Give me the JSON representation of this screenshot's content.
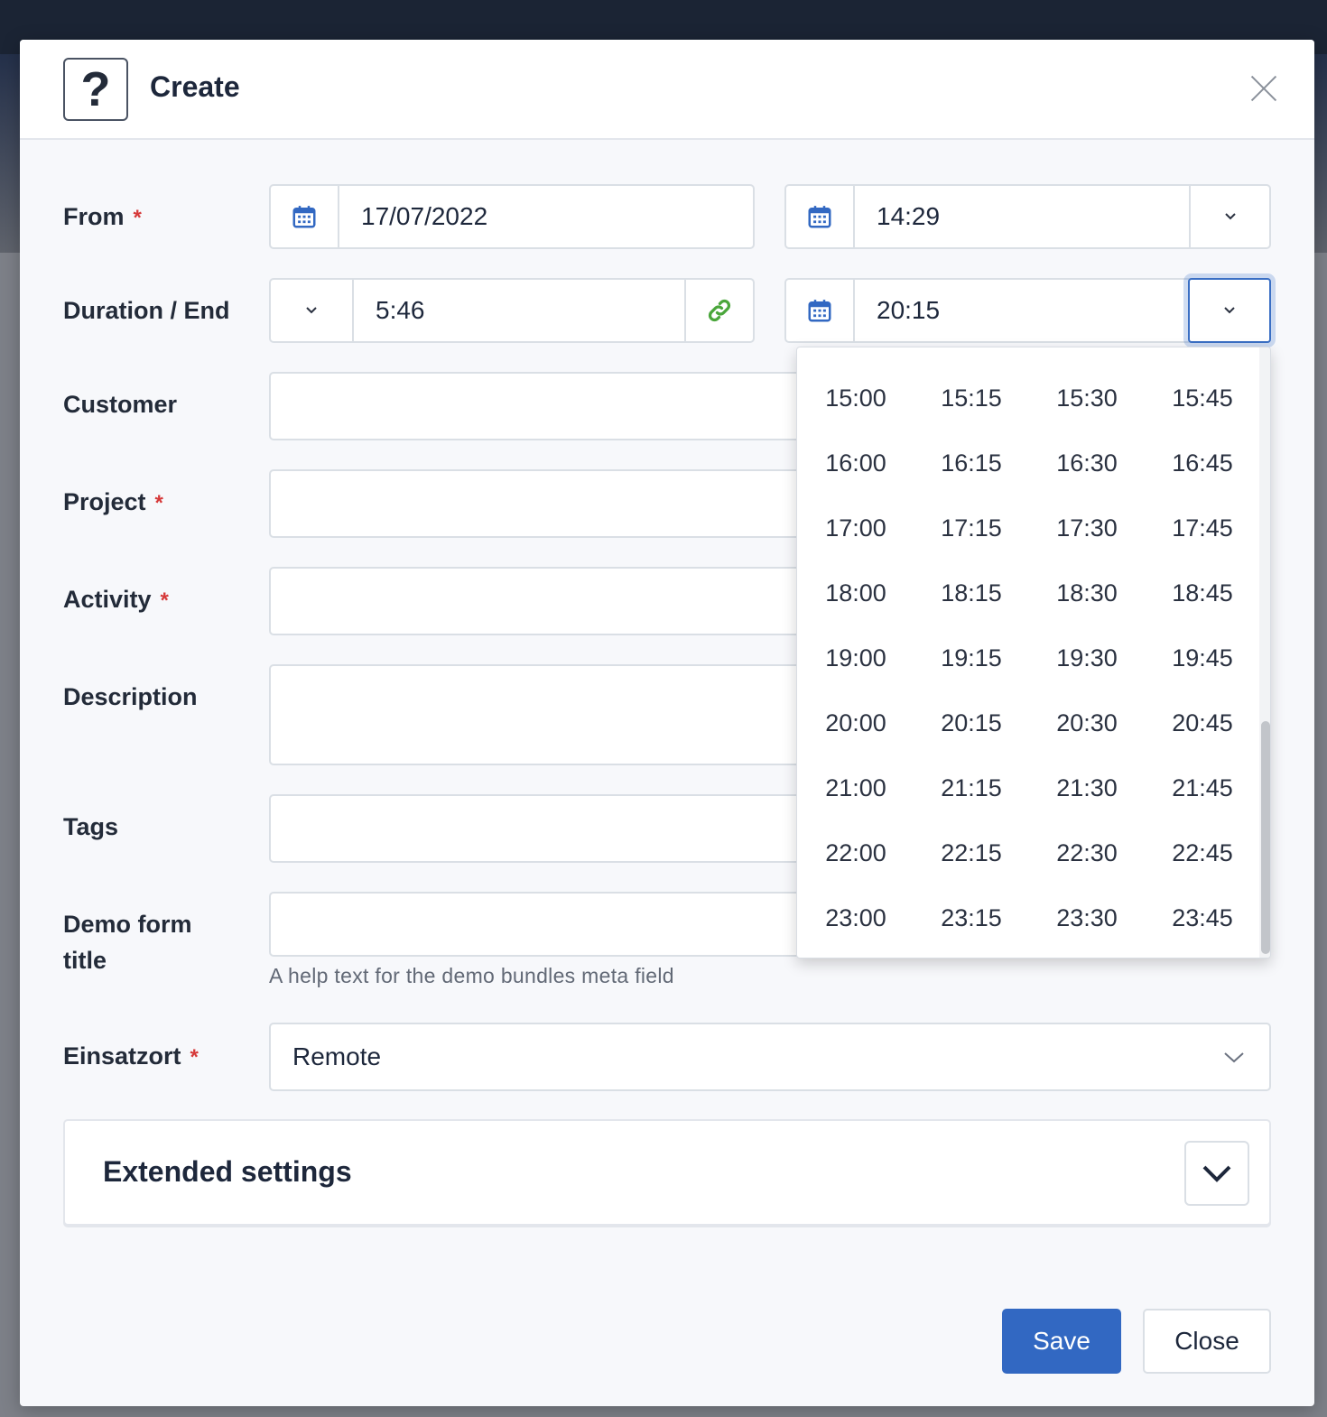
{
  "modal": {
    "title": "Create",
    "help_icon": "question-icon",
    "close_icon": "close-icon"
  },
  "form": {
    "from": {
      "label": "From",
      "required": "*",
      "date": "17/07/2022",
      "time": "14:29"
    },
    "duration_end": {
      "label": "Duration / End",
      "duration": "5:46",
      "end_time": "20:15"
    },
    "customer": {
      "label": "Customer"
    },
    "project": {
      "label": "Project",
      "required": "*"
    },
    "activity": {
      "label": "Activity",
      "required": "*"
    },
    "description": {
      "label": "Description"
    },
    "tags": {
      "label": "Tags"
    },
    "demo_form_title": {
      "label_line1": "Demo form",
      "label_line2": "title",
      "help": "A help text for the demo bundles meta field"
    },
    "einsatzort": {
      "label": "Einsatzort",
      "required": "*",
      "value": "Remote"
    }
  },
  "timepicker": {
    "times": [
      "15:00",
      "15:15",
      "15:30",
      "15:45",
      "16:00",
      "16:15",
      "16:30",
      "16:45",
      "17:00",
      "17:15",
      "17:30",
      "17:45",
      "18:00",
      "18:15",
      "18:30",
      "18:45",
      "19:00",
      "19:15",
      "19:30",
      "19:45",
      "20:00",
      "20:15",
      "20:30",
      "20:45",
      "21:00",
      "21:15",
      "21:30",
      "21:45",
      "22:00",
      "22:15",
      "22:30",
      "22:45",
      "23:00",
      "23:15",
      "23:30",
      "23:45"
    ]
  },
  "extended": {
    "title": "Extended settings"
  },
  "buttons": {
    "save": "Save",
    "close": "Close"
  },
  "colors": {
    "primary": "#3268c2",
    "required": "#d63939",
    "link_icon": "#4aa63b",
    "calendar_icon": "#3268c2"
  }
}
